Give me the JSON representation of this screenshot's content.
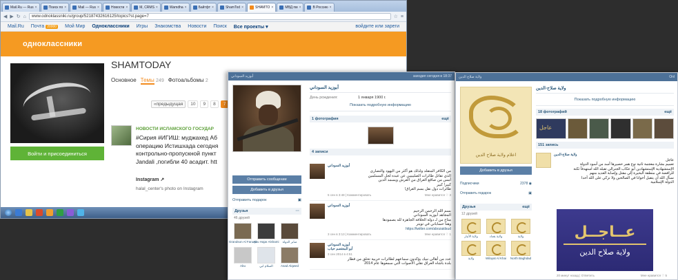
{
  "back_window": {
    "tabs": [
      {
        "label": "Mail.Ru — Rus",
        "active": false
      },
      {
        "label": "Поиск по",
        "active": false
      },
      {
        "label": "Mail — Rus",
        "active": false
      },
      {
        "label": "Новости",
        "active": false
      },
      {
        "label": "M, CRMS",
        "active": false
      },
      {
        "label": "Wamdha",
        "active": false
      },
      {
        "label": "Байтфт",
        "active": false
      },
      {
        "label": "ShamTod",
        "active": false
      },
      {
        "label": "SHAMTO",
        "active": true
      },
      {
        "label": "МВД пм",
        "active": false
      },
      {
        "label": "В Россию",
        "active": false
      }
    ],
    "url": "www.odnoklassniki.ru/group/52187432616125/topics?st.page=7",
    "mail_nav": {
      "items": [
        "Mail.Ru",
        "Почта",
        "Мой Мир",
        "Одноклассники",
        "Игры",
        "Знакомства",
        "Новости",
        "Поиск",
        "Все проекты ▾"
      ],
      "mail_count": "20000",
      "right_link": "войдите или зареги"
    },
    "site_logo": "одноклассники",
    "group": {
      "name": "SHAMTODAY",
      "tabs": [
        {
          "label": "Основное",
          "count": "",
          "active": false
        },
        {
          "label": "Темы",
          "count": "249",
          "active": true
        },
        {
          "label": "Фотоальбомы",
          "count": "2",
          "active": false
        }
      ],
      "join_button": "Войти и присоединиться",
      "pager": {
        "prev": "«предыдущая",
        "pages": [
          "10",
          "9",
          "8",
          "7"
        ],
        "current": "7"
      },
      "post": {
        "source": "НОВОСТИ ИСЛАМСКОГО ГОСУДАР",
        "lines": [
          "#Сирия #ИГИШ: муджахед Аб",
          "операцию Истишхада сегодня",
          "контрольно-пропускной пункт",
          "Jandali ,погибли 40 асадит. htt"
        ],
        "instagram": "Instagram",
        "caption": "halal_center's photo on Instagram"
      }
    }
  },
  "profile_window": {
    "topbar_left": "أبوزيد السوداني",
    "topbar_right": "заходил сегодня в 18:37",
    "name": "أبوزيد السوداني",
    "birth_label": "День рождения:",
    "birth_value": "1 января 1900 г.",
    "more_info": "Показать подробную информацию",
    "photos_band": "1 фотография",
    "photos_band_right": "ещё",
    "wall_band": "4 записи",
    "send_message": "Отправить сообщение",
    "add_friend": "Добавить в друзья",
    "send_gift": "Отправить подарок",
    "friends_section": "Друзья",
    "friends_count": "46 друзей",
    "friends": [
      {
        "name": "Grandson Al Faruqu"
      },
      {
        "name": "Abu Hajar Alshami"
      },
      {
        "name": "صابر الدولة"
      },
      {
        "name": "Abu",
        "sub": "ابوبكر"
      },
      {
        "name": "السلام ابي"
      },
      {
        "name": "Asad Alqwed"
      }
    ],
    "posts": [
      {
        "author": "أبوزيد السوداني",
        "text": [
          "من الكافر المتقلد ولذلك هو أكثر من اليهود والنصارى",
          "الذي تقاتل طائرات الصليبيين عن عبده لجل المسلمين",
          "أمس من صاقع العراق من العرش ويسمد الدين",
          "كبير! كبير",
          "طائرات دول نقل بسم العراق!"
        ],
        "meta": "5 сен в 3:48 | Комментировать",
        "likes": "Мне нравится ♡ 3"
      },
      {
        "author": "أبوزيد السوداني",
        "text": [
          "بسم الله الرحمن الرحيم",
          "المجاهد أبوزيد السوداني",
          "متاح من لـ دولة الخلافة الجاهزة لله بصمودها",
          "وهنا حساباتي في تويتر"
        ],
        "link": "https://twitter.com/abozaidsud",
        "meta": "3 сен в 3:13 | Комментировать",
        "likes": "Мне нравится ♡ 1"
      },
      {
        "author": "أبوزيد السوداني",
        "sub_author": "أبو المعتصم حباب",
        "meta_top": "3 сен 2014 в 4:51",
        "text": [
          "عدد من أهالي نبيك يؤكدون سماعهم لطائرات حربية تحلق من فطار",
          "بلدة باشاه العراق نقلي الأصوات التي سمعوها عام 2014"
        ],
        "meta": "",
        "likes": ""
      }
    ]
  },
  "group_window": {
    "topbar_left": "ولاية صلاح الدين",
    "topbar_right": "Onl",
    "logo_caption": "اعلام ولاية صلاح الدين",
    "join": "Добавить в друзья",
    "subscribers_label": "Подписчики",
    "subscribers_value": "ولاية صلاح الدين",
    "subscribers_count": "2378 ◉",
    "send_gift": "Отправить подарок",
    "friends_section": "Друзья",
    "friends_count": "12 друзей",
    "friends_right": "ещё",
    "friends": [
      {
        "name": "ولاية الأنبار"
      },
      {
        "name": "ولاية بغداد"
      },
      {
        "name": "ولاية"
      },
      {
        "name": "ولاية"
      },
      {
        "name": "Wilayat Al Khai"
      },
      {
        "name": "North Baghdad"
      }
    ],
    "name": "ولاية صلاح-الدين",
    "more_info": "Показать подробную информацию",
    "photos_band": "18 фотографий",
    "photos_band_right": "ещё",
    "wall_band": "151 запись",
    "post": {
      "author": "ولاية صلاح-الدين",
      "online": "Online",
      "text": [
        "عاجل",
        "تعميم بشارة معجمة ثانية نوع همر حصيرها أسد من أسود الدولة",
        "الإستشهادية الإستشهادين أبو عكاب الجنرالي تقبله الله استهدفاً ثكنة",
        "للرافضة في منطقة البحيرة إلي مقتل وإصابة العديد منهم",
        "نسأل الله أن يتقبل أخوانا في الصالحين ولا نزكي على الله أحدا",
        "الدولة الإسلامية"
      ]
    },
    "banner": {
      "line1": "عــاجــل",
      "line2": "ولاية صلاح الدين"
    },
    "footer_left": "20 минут назад | Ответить",
    "footer_right": "Мне нравится ♡ 5"
  }
}
